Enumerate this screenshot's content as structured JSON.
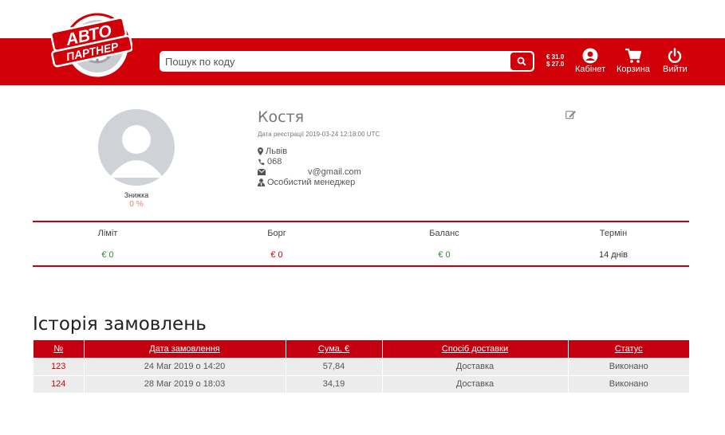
{
  "header": {
    "logo_line1": "АВТО",
    "logo_line2": "ПАРТНЕР",
    "search_placeholder": "Пошук по коду",
    "rate_eur": "€ 31.0",
    "rate_usd": "$ 27.0",
    "cabinet_label": "Кабінет",
    "cart_label": "Корзина",
    "logout_label": "Вийти"
  },
  "profile": {
    "name": "Костя",
    "registration": "Дата реєстрації 2019-03-24 12:18:00 UTC",
    "city": "Львів",
    "phone": "068",
    "email": "v@gmail.com",
    "manager": "Особистий менеджер",
    "discount_label": "Знижка",
    "discount_value": "0 %"
  },
  "stats": [
    {
      "label": "Ліміт",
      "value": "€ 0",
      "color": "#2e8b2e"
    },
    {
      "label": "Борг",
      "value": "€ 0",
      "color": "#d10008"
    },
    {
      "label": "Баланс",
      "value": "€ 0",
      "color": "#2e8b2e"
    },
    {
      "label": "Термін",
      "value": "14 днів",
      "color": "#333333"
    }
  ],
  "history": {
    "title": "Історія замовлень",
    "columns": [
      "№",
      "Дата замовлення",
      "Сума, €",
      "Спосіб доставки",
      "Статус"
    ],
    "rows": [
      [
        "123",
        "24 Mar 2019 о 14:20",
        "57,84",
        "Доставка",
        "Виконано"
      ],
      [
        "124",
        "28 Mar 2019 о 18:03",
        "34,19",
        "Доставка",
        "Виконано"
      ]
    ]
  },
  "colors": {
    "brand": "#d10008",
    "accent_discount": "#f07d5c"
  }
}
